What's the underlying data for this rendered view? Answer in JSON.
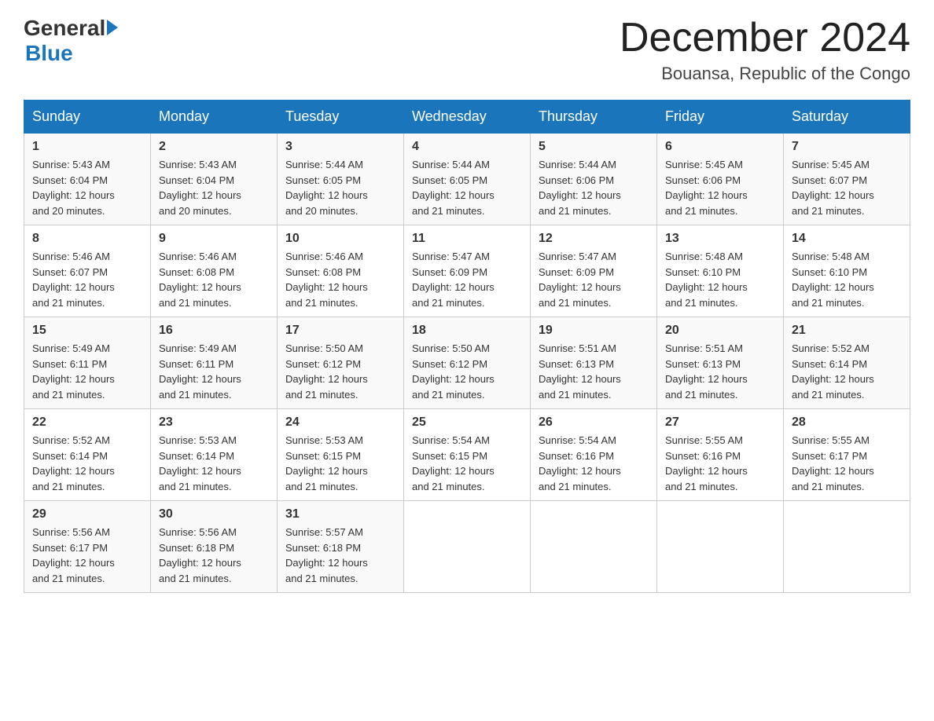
{
  "logo": {
    "text_general": "General",
    "text_blue": "Blue"
  },
  "header": {
    "month_year": "December 2024",
    "location": "Bouansa, Republic of the Congo"
  },
  "days_of_week": [
    "Sunday",
    "Monday",
    "Tuesday",
    "Wednesday",
    "Thursday",
    "Friday",
    "Saturday"
  ],
  "weeks": [
    [
      {
        "day": "1",
        "sunrise": "5:43 AM",
        "sunset": "6:04 PM",
        "daylight": "12 hours and 20 minutes."
      },
      {
        "day": "2",
        "sunrise": "5:43 AM",
        "sunset": "6:04 PM",
        "daylight": "12 hours and 20 minutes."
      },
      {
        "day": "3",
        "sunrise": "5:44 AM",
        "sunset": "6:05 PM",
        "daylight": "12 hours and 20 minutes."
      },
      {
        "day": "4",
        "sunrise": "5:44 AM",
        "sunset": "6:05 PM",
        "daylight": "12 hours and 21 minutes."
      },
      {
        "day": "5",
        "sunrise": "5:44 AM",
        "sunset": "6:06 PM",
        "daylight": "12 hours and 21 minutes."
      },
      {
        "day": "6",
        "sunrise": "5:45 AM",
        "sunset": "6:06 PM",
        "daylight": "12 hours and 21 minutes."
      },
      {
        "day": "7",
        "sunrise": "5:45 AM",
        "sunset": "6:07 PM",
        "daylight": "12 hours and 21 minutes."
      }
    ],
    [
      {
        "day": "8",
        "sunrise": "5:46 AM",
        "sunset": "6:07 PM",
        "daylight": "12 hours and 21 minutes."
      },
      {
        "day": "9",
        "sunrise": "5:46 AM",
        "sunset": "6:08 PM",
        "daylight": "12 hours and 21 minutes."
      },
      {
        "day": "10",
        "sunrise": "5:46 AM",
        "sunset": "6:08 PM",
        "daylight": "12 hours and 21 minutes."
      },
      {
        "day": "11",
        "sunrise": "5:47 AM",
        "sunset": "6:09 PM",
        "daylight": "12 hours and 21 minutes."
      },
      {
        "day": "12",
        "sunrise": "5:47 AM",
        "sunset": "6:09 PM",
        "daylight": "12 hours and 21 minutes."
      },
      {
        "day": "13",
        "sunrise": "5:48 AM",
        "sunset": "6:10 PM",
        "daylight": "12 hours and 21 minutes."
      },
      {
        "day": "14",
        "sunrise": "5:48 AM",
        "sunset": "6:10 PM",
        "daylight": "12 hours and 21 minutes."
      }
    ],
    [
      {
        "day": "15",
        "sunrise": "5:49 AM",
        "sunset": "6:11 PM",
        "daylight": "12 hours and 21 minutes."
      },
      {
        "day": "16",
        "sunrise": "5:49 AM",
        "sunset": "6:11 PM",
        "daylight": "12 hours and 21 minutes."
      },
      {
        "day": "17",
        "sunrise": "5:50 AM",
        "sunset": "6:12 PM",
        "daylight": "12 hours and 21 minutes."
      },
      {
        "day": "18",
        "sunrise": "5:50 AM",
        "sunset": "6:12 PM",
        "daylight": "12 hours and 21 minutes."
      },
      {
        "day": "19",
        "sunrise": "5:51 AM",
        "sunset": "6:13 PM",
        "daylight": "12 hours and 21 minutes."
      },
      {
        "day": "20",
        "sunrise": "5:51 AM",
        "sunset": "6:13 PM",
        "daylight": "12 hours and 21 minutes."
      },
      {
        "day": "21",
        "sunrise": "5:52 AM",
        "sunset": "6:14 PM",
        "daylight": "12 hours and 21 minutes."
      }
    ],
    [
      {
        "day": "22",
        "sunrise": "5:52 AM",
        "sunset": "6:14 PM",
        "daylight": "12 hours and 21 minutes."
      },
      {
        "day": "23",
        "sunrise": "5:53 AM",
        "sunset": "6:14 PM",
        "daylight": "12 hours and 21 minutes."
      },
      {
        "day": "24",
        "sunrise": "5:53 AM",
        "sunset": "6:15 PM",
        "daylight": "12 hours and 21 minutes."
      },
      {
        "day": "25",
        "sunrise": "5:54 AM",
        "sunset": "6:15 PM",
        "daylight": "12 hours and 21 minutes."
      },
      {
        "day": "26",
        "sunrise": "5:54 AM",
        "sunset": "6:16 PM",
        "daylight": "12 hours and 21 minutes."
      },
      {
        "day": "27",
        "sunrise": "5:55 AM",
        "sunset": "6:16 PM",
        "daylight": "12 hours and 21 minutes."
      },
      {
        "day": "28",
        "sunrise": "5:55 AM",
        "sunset": "6:17 PM",
        "daylight": "12 hours and 21 minutes."
      }
    ],
    [
      {
        "day": "29",
        "sunrise": "5:56 AM",
        "sunset": "6:17 PM",
        "daylight": "12 hours and 21 minutes."
      },
      {
        "day": "30",
        "sunrise": "5:56 AM",
        "sunset": "6:18 PM",
        "daylight": "12 hours and 21 minutes."
      },
      {
        "day": "31",
        "sunrise": "5:57 AM",
        "sunset": "6:18 PM",
        "daylight": "12 hours and 21 minutes."
      },
      null,
      null,
      null,
      null
    ]
  ],
  "labels": {
    "sunrise": "Sunrise:",
    "sunset": "Sunset:",
    "daylight": "Daylight:"
  }
}
